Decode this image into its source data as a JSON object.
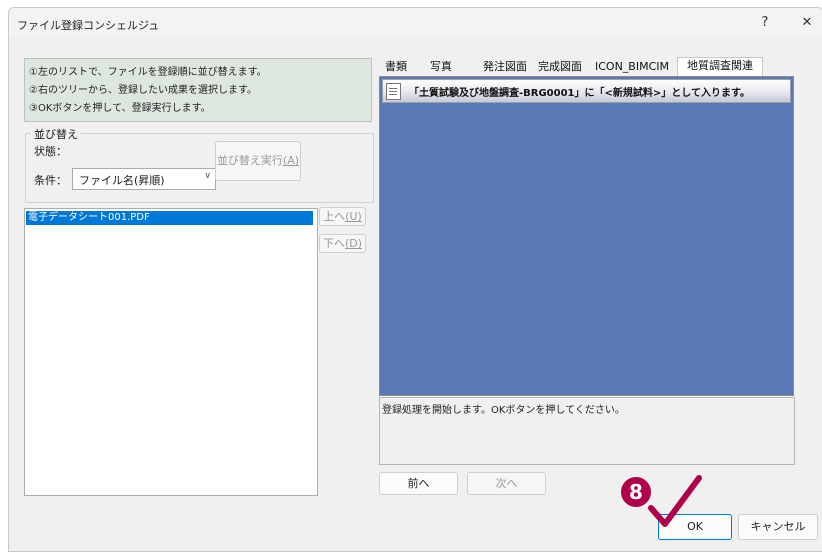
{
  "window": {
    "title": "ファイル登録コンシェルジュ",
    "help_label": "?",
    "close_label": "✕"
  },
  "instructions": [
    "①左のリストで、ファイルを登録順に並び替えます。",
    "②右のツリーから、登録したい成果を選択します。",
    "③OKボタンを押して、登録実行します。"
  ],
  "sort_group": {
    "legend": "並び替え",
    "state_label": "状態：",
    "condition_label": "条件：",
    "condition_value": "ファイル名(昇順)",
    "execute_label": "並び替え実行",
    "execute_key": "(A)"
  },
  "file_list": {
    "items": [
      "電子データシート001.PDF"
    ]
  },
  "move_buttons": {
    "up_label": "上へ",
    "up_key": "(U)",
    "down_label": "下へ",
    "down_key": "(D)"
  },
  "tabs": [
    "書類",
    "写真",
    "発注図面",
    "完成図面",
    "ICON_BIMCIM",
    "地質調査関連"
  ],
  "selected_tab": "地質調査関連",
  "tree_header": "「土質試験及び地盤調査-BRG0001」に「<新規試料>」として入ります。",
  "status_message": "登録処理を開始します。OKボタンを押してください。",
  "nav": {
    "prev_label": "前へ",
    "next_label": "次へ"
  },
  "footer": {
    "ok_label": "OK",
    "cancel_label": "キャンセル"
  },
  "annotation": {
    "step_number": "8",
    "badge_color": "#b0004c",
    "check_color": "#b0004c"
  },
  "colors": {
    "selection": "#0078d7",
    "tree_background": "#5b78b6",
    "instruction_background": "#dde6df"
  }
}
